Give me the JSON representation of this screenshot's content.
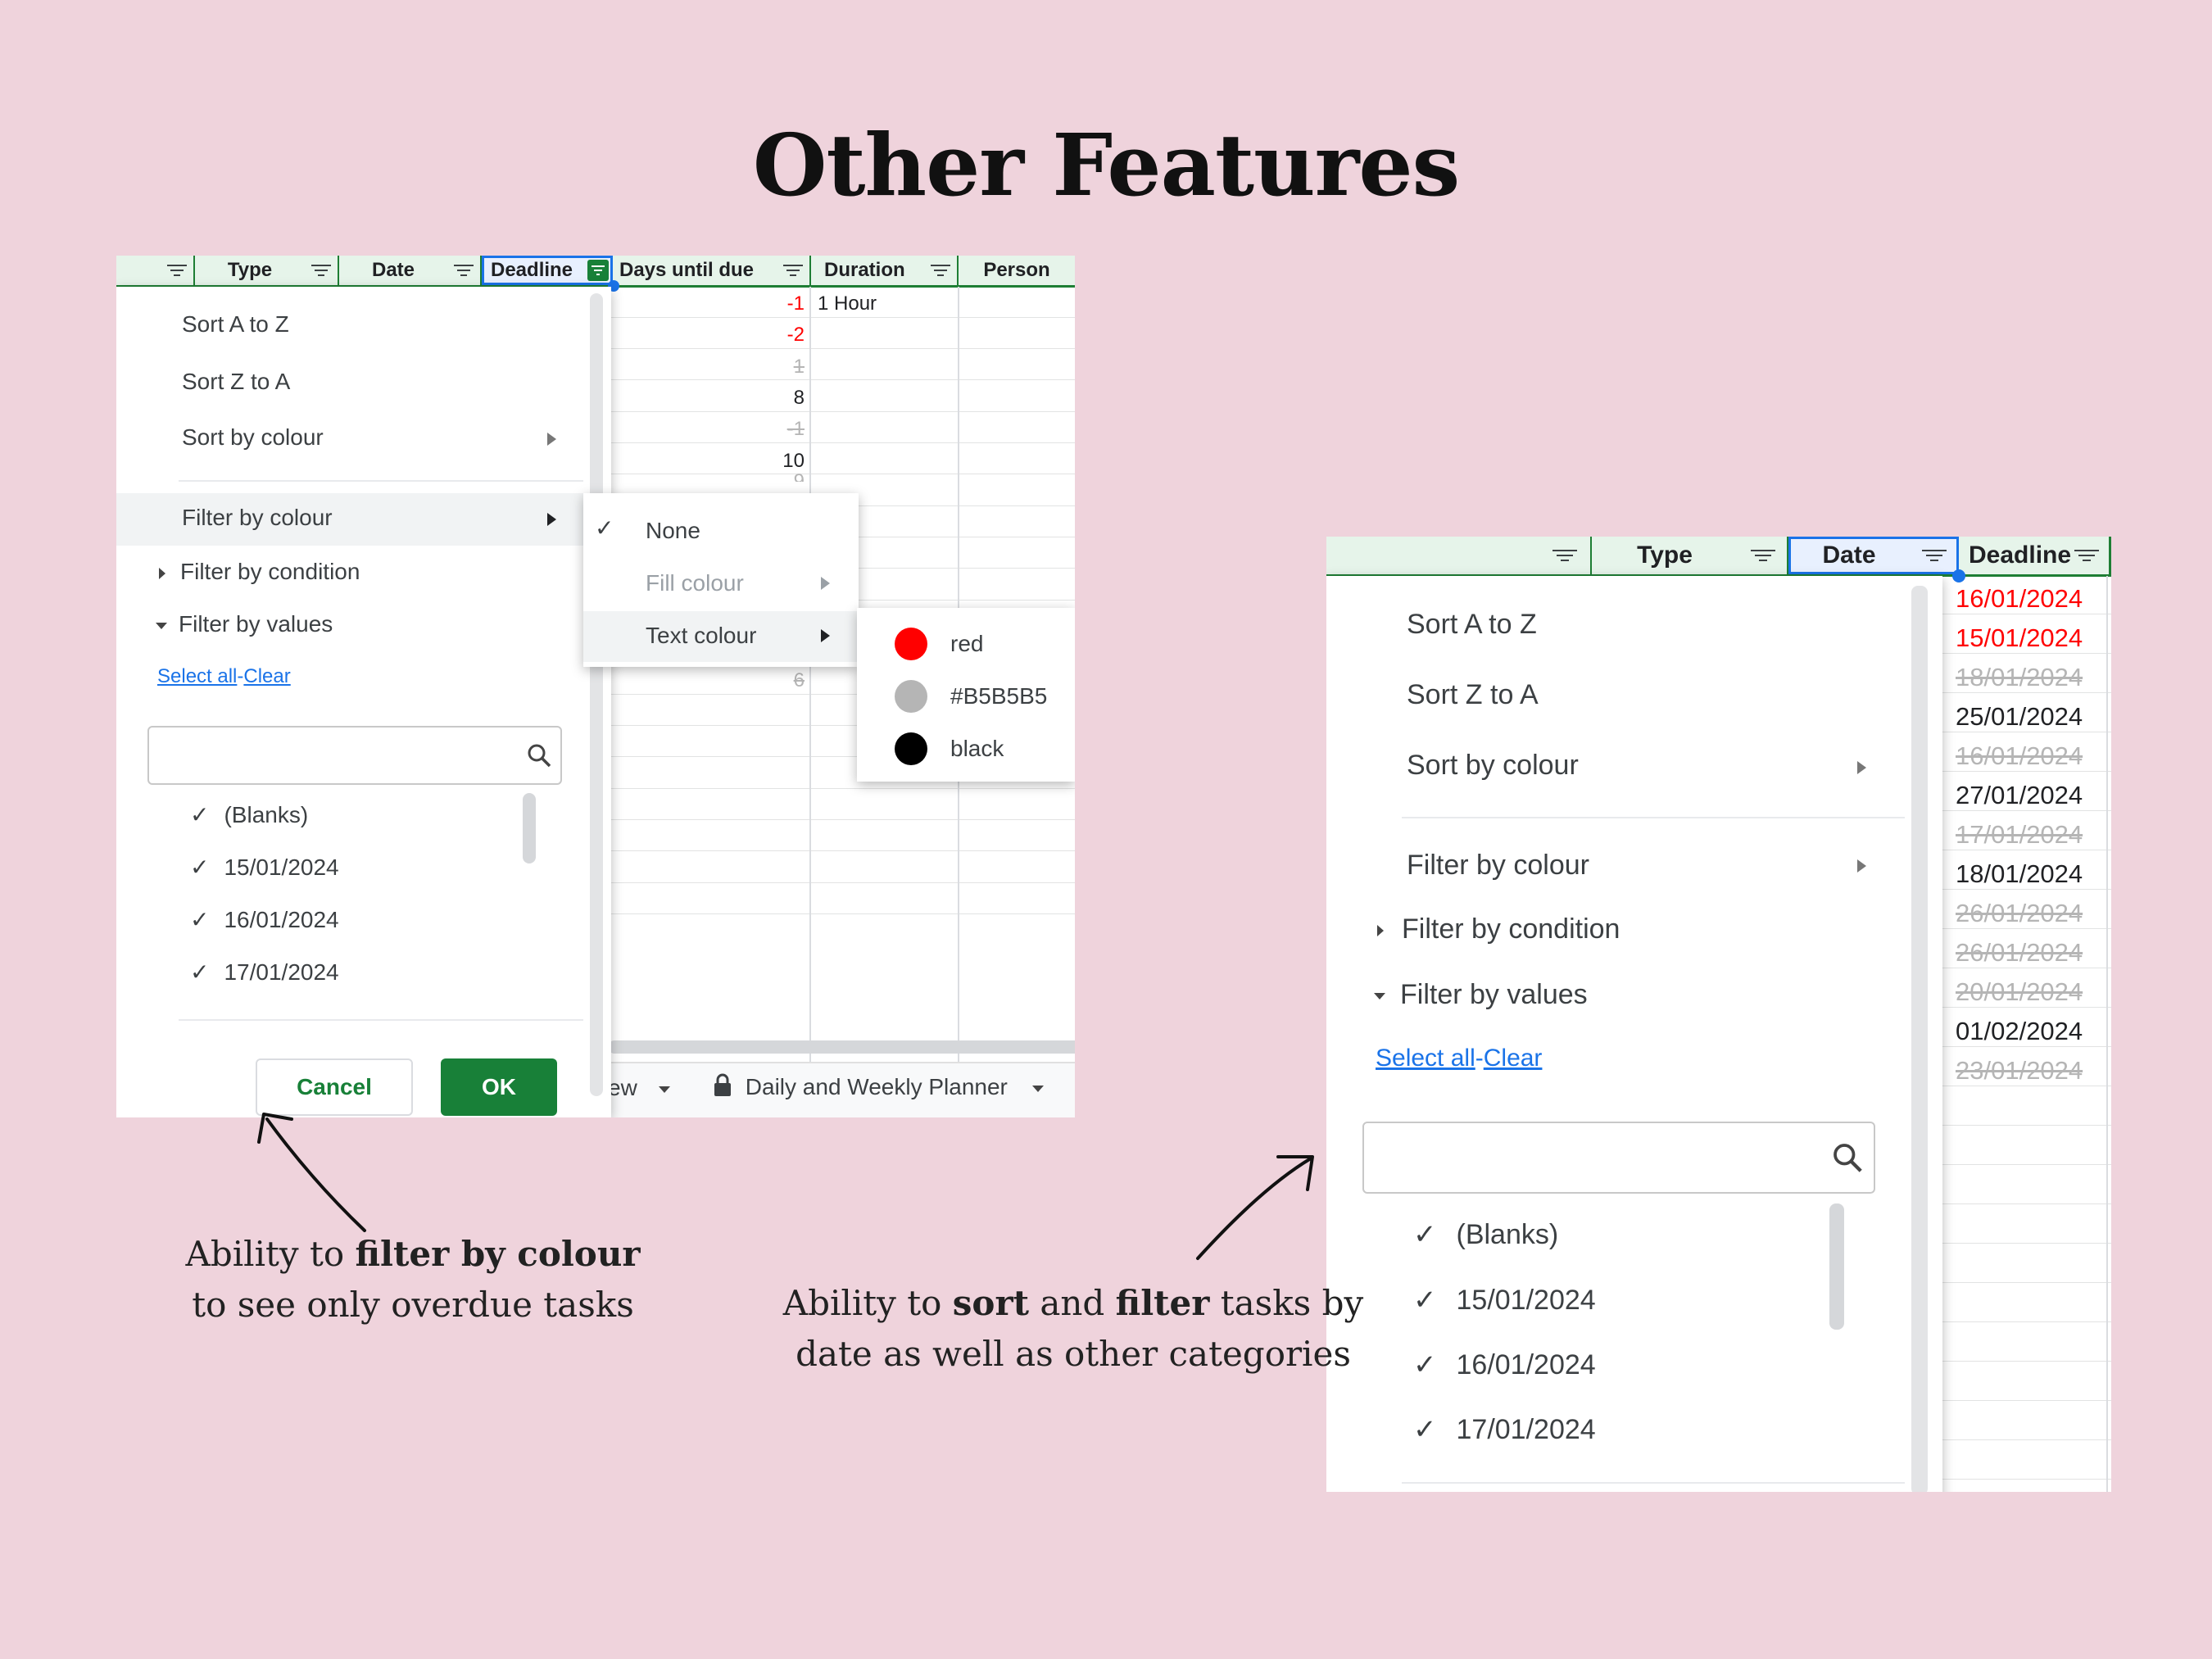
{
  "title": "Other Features",
  "colors": {
    "background": "#efd3dc",
    "header_bg": "#e6f4ea",
    "header_line": "#1e7e34",
    "ok_button": "#188038",
    "red": "#ff0000",
    "grey": "#b5b5b5",
    "link": "#1a73e8"
  },
  "left": {
    "headers": {
      "type": "Type",
      "date": "Date",
      "deadline": "Deadline",
      "days": "Days until due",
      "duration": "Duration",
      "person": "Person"
    },
    "days_values": [
      "-1",
      "-2",
      "1",
      "8",
      "-1",
      "10",
      "9",
      "6"
    ],
    "duration_first": "1 Hour",
    "menu": {
      "sort_az": "Sort A to Z",
      "sort_za": "Sort Z to A",
      "sort_colour": "Sort by colour",
      "filter_colour": "Filter by colour",
      "filter_condition": "Filter by condition",
      "filter_values": "Filter by values",
      "select_all": "Select all",
      "dash": "-",
      "clear": "Clear",
      "values": [
        "(Blanks)",
        "15/01/2024",
        "16/01/2024",
        "17/01/2024"
      ],
      "cancel": "Cancel",
      "ok": "OK"
    },
    "submenu1": {
      "none": "None",
      "fill": "Fill colour",
      "text": "Text colour"
    },
    "submenu2": {
      "red": "red",
      "grey": "#B5B5B5",
      "black": "black"
    },
    "tabs": {
      "partial": "ew",
      "planner": "Daily and Weekly Planner"
    }
  },
  "right": {
    "headers": {
      "type": "Type",
      "date": "Date",
      "deadline": "Deadline"
    },
    "deadlines": [
      "16/01/2024",
      "15/01/2024",
      "18/01/2024",
      "25/01/2024",
      "16/01/2024",
      "27/01/2024",
      "17/01/2024",
      "18/01/2024",
      "26/01/2024",
      "26/01/2024",
      "20/01/2024",
      "01/02/2024",
      "23/01/2024"
    ],
    "menu": {
      "sort_az": "Sort A to Z",
      "sort_za": "Sort Z to A",
      "sort_colour": "Sort by colour",
      "filter_colour": "Filter by colour",
      "filter_condition": "Filter by condition",
      "filter_values": "Filter by values",
      "select_all": "Select all",
      "dash": "-",
      "clear": "Clear",
      "values": [
        "(Blanks)",
        "15/01/2024",
        "16/01/2024",
        "17/01/2024"
      ]
    }
  },
  "captions": {
    "left_pre": "Ability to ",
    "left_bold": "filter by colour",
    "left_line2": "to see only overdue tasks",
    "right_pre": "Ability to ",
    "right_bold1": "sort",
    "right_mid": " and ",
    "right_bold2": "filter",
    "right_post": " tasks by",
    "right_line2": "date as well as other categories"
  }
}
